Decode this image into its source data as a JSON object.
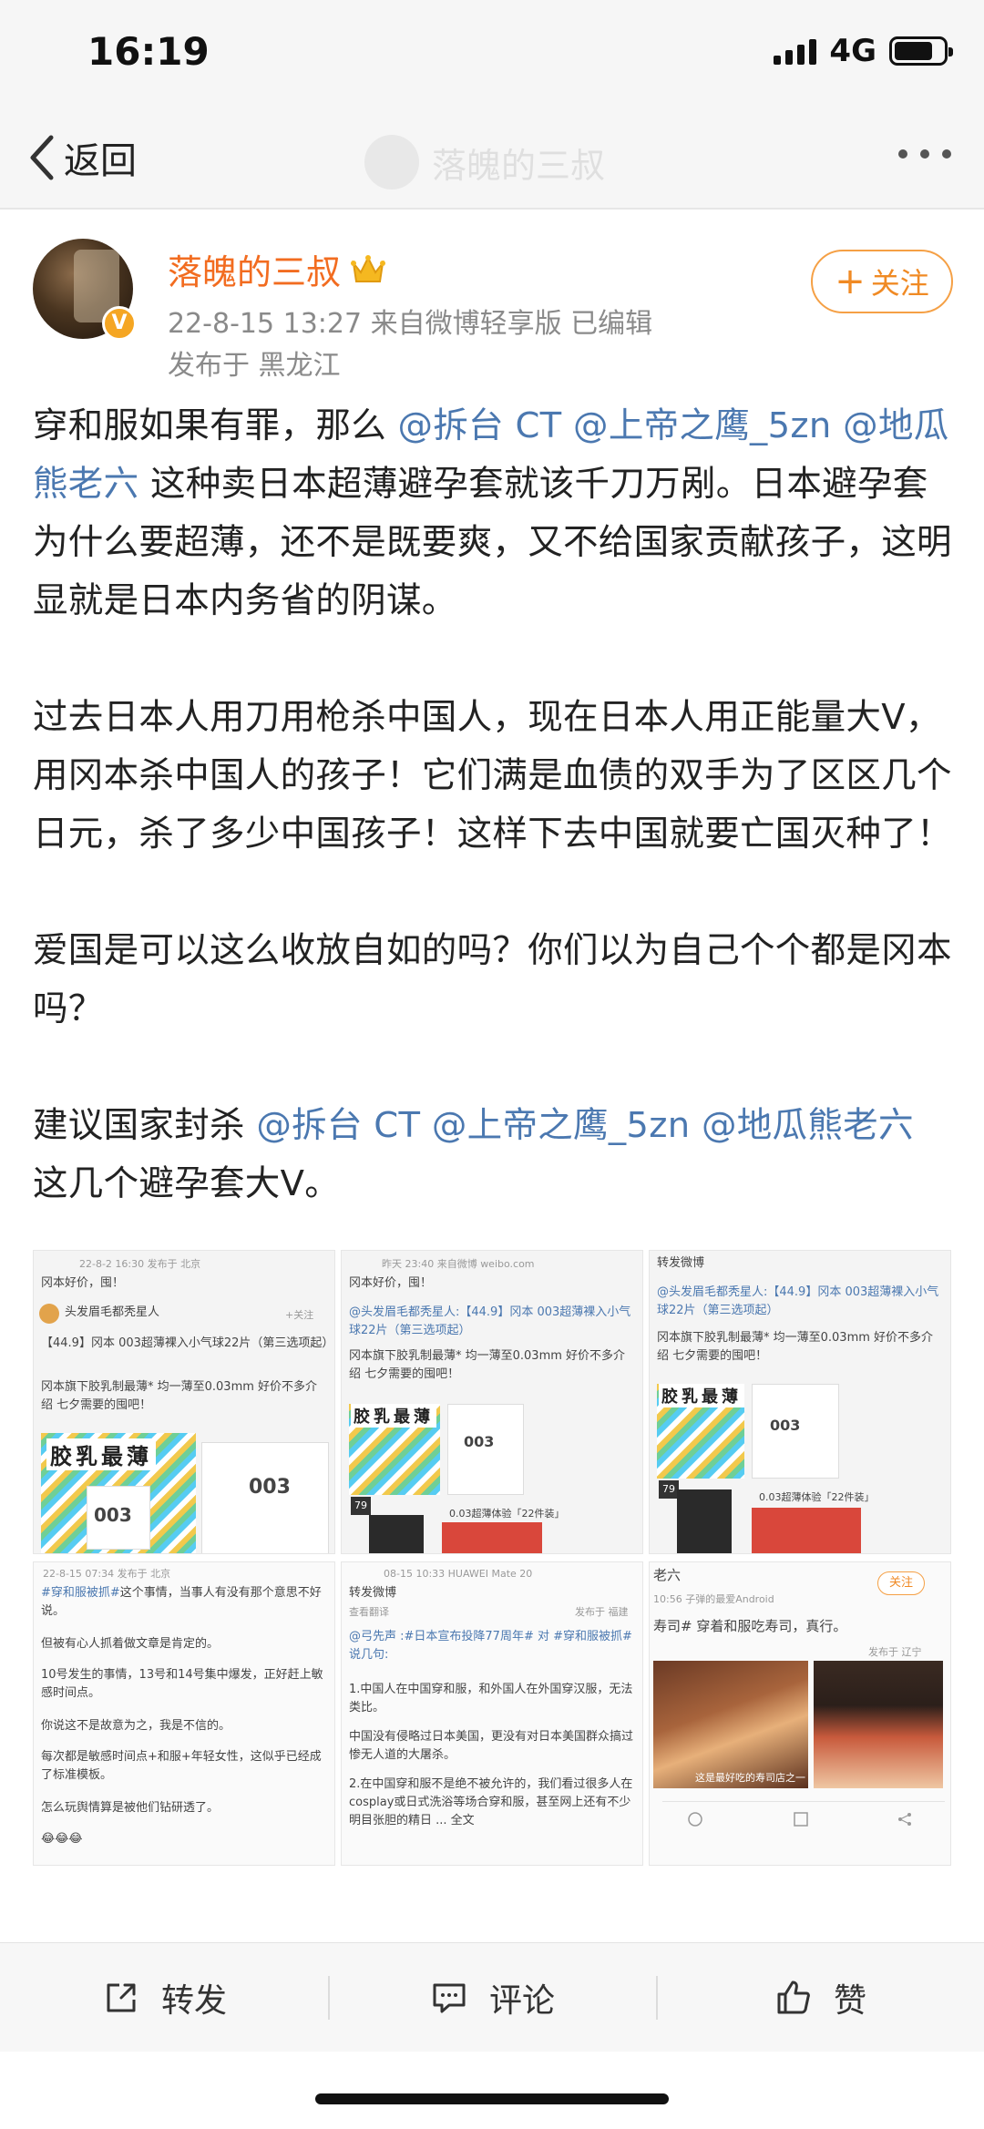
{
  "status": {
    "time": "16:19",
    "network": "4G"
  },
  "nav": {
    "back_label": "返回",
    "ghost_title": "落魄的三叔"
  },
  "author": {
    "name": "落魄的三叔",
    "verified_badge": "V",
    "meta": "22-8-15 13:27  来自微博轻享版  已编辑",
    "location": "发布于 黑龙江",
    "follow_label": "关注"
  },
  "post": {
    "p1": [
      {
        "t": "穿和服如果有罪，那么 "
      },
      {
        "t": "@拆台 CT",
        "m": true
      },
      {
        "t": " "
      },
      {
        "t": "@上帝之鹰_5zn",
        "m": true
      },
      {
        "t": " "
      },
      {
        "t": "@地瓜熊老六",
        "m": true
      },
      {
        "t": " 这种卖日本超薄避孕套就该千刀万剐。日本避孕套为什么要超薄，还不是既要爽，又不给国家贡献孩子，这明显就是日本内务省的阴谋。"
      }
    ],
    "p2": "过去日本人用刀用枪杀中国人，现在日本人用正能量大V，用冈本杀中国人的孩子！它们满是血债的双手为了区区几个日元，杀了多少中国孩子！这样下去中国就要亡国灭种了！",
    "p3": "爱国是可以这么收放自如的吗？你们以为自己个个都是冈本吗？",
    "p4": [
      {
        "t": "建议国家封杀 "
      },
      {
        "t": "@拆台 CT",
        "m": true
      },
      {
        "t": " "
      },
      {
        "t": "@上帝之鹰_5zn",
        "m": true
      },
      {
        "t": " "
      },
      {
        "t": "@地瓜熊老六",
        "m": true
      },
      {
        "t": " 这几个避孕套大V。"
      }
    ]
  },
  "images": {
    "img1": {
      "meta": "22-8-2 16:30  发布于 北京",
      "line1": "冈本好价，囤！",
      "user": "头发眉毛都秃星人",
      "follow": "+关注",
      "text1": "【44.9】冈本 003超薄裸入小气球22片（第三选项起）",
      "text2": "冈本旗下胶乳制最薄* 均一薄至0.03mm  好价不多介绍 七夕需要的囤吧！",
      "prod_title": "胶乳最薄",
      "prod_num": "003"
    },
    "img2": {
      "meta": "昨天 23:40  来自微博 weibo.com",
      "line1": "冈本好价，囤！",
      "text1": "@头发眉毛都秃星人:【44.9】冈本 003超薄裸入小气球22片（第三选项起）",
      "text2": "冈本旗下胶乳制最薄* 均一薄至0.03mm  好价不多介绍 七夕需要的囤吧！",
      "prod_title": "胶乳最薄",
      "prod_num": "003",
      "price": "79",
      "tag": "0.03超薄体验「22件装」"
    },
    "img3": {
      "header": "转发微博",
      "text1": "@头发眉毛都秃星人:【44.9】冈本 003超薄裸入小气球22片（第三选项起）",
      "text2": "冈本旗下胶乳制最薄* 均一薄至0.03mm  好价不多介绍 七夕需要的囤吧！",
      "prod_title": "胶乳最薄",
      "prod_num": "003",
      "price": "79",
      "tag": "0.03超薄体验「22件装」"
    },
    "img4": {
      "meta": "22-8-15 07:34  发布于 北京",
      "hashtag": "#穿和服被抓#",
      "l1": "这个事情，当事人有没有那个意思不好说。",
      "l2": "但被有心人抓着做文章是肯定的。",
      "l3": "10号发生的事情，13号和14号集中爆发，正好赶上敏感时间点。",
      "l4": "你说这不是故意为之，我是不信的。",
      "l5": "每次都是敏感时间点+和服+年轻女性，这似乎已经成了标准模板。",
      "l6": "怎么玩舆情算是被他们钻研透了。",
      "emoji": "😂😂😂"
    },
    "img5": {
      "meta": "08-15 10:33  HUAWEI Mate 20",
      "header": "转发微博",
      "sub": "查看翻译",
      "loc": "发布于 福建",
      "text1": "@弓先声 :#日本宣布投降77周年# 对 #穿和服被抓# 说几句:",
      "text2": "1.中国人在中国穿和服，和外国人在外国穿汉服，无法类比。",
      "text3": "中国没有侵略过日本美国，更没有对日本美国群众搞过惨无人道的大屠杀。",
      "text4": "2.在中国穿和服不是绝不被允许的，我们看过很多人在cosplay或日式洗浴等场合穿和服，甚至网上还有不少明目张胆的精日 ... 全文"
    },
    "img6": {
      "name": "老六",
      "meta": "10:56  子弹的最爱Android",
      "follow": "关注",
      "text": "寿司# 穿着和服吃寿司，真行。",
      "loc": "发布于 辽宁",
      "caption": "这是最好吃的寿司店之一"
    }
  },
  "actions": {
    "repost": "转发",
    "comment": "评论",
    "like": "赞"
  },
  "colors": {
    "accent": "#f26c20",
    "mention": "#4b78b0",
    "follow_border": "#f5a045"
  }
}
